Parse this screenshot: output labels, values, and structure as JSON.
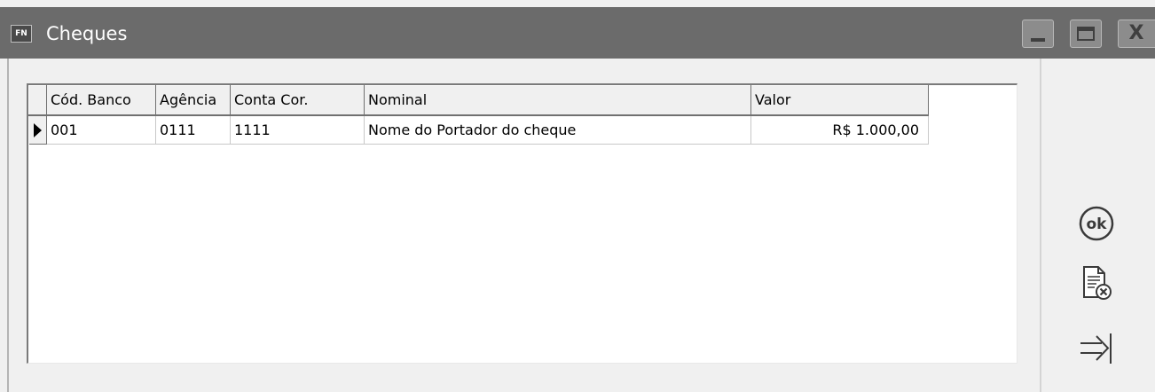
{
  "window": {
    "title": "Cheques",
    "icon_label": "FN",
    "controls": [
      "minimize-icon",
      "maximize-icon",
      "close-icon"
    ],
    "close_glyph": "X"
  },
  "grid": {
    "columns": [
      "Cód. Banco",
      "Agência",
      "Conta Cor.",
      "Nominal",
      "Valor"
    ],
    "rows": [
      {
        "cod_banco": "001",
        "agencia": "0111",
        "conta_cor": "1111",
        "nominal": "Nome do Portador do cheque",
        "valor": "R$ 1.000,00",
        "current": true
      }
    ]
  },
  "side_buttons": {
    "ok": "ok",
    "cancel_icon": "document-cancel-icon",
    "exit_icon": "exit-arrow-icon"
  },
  "colors": {
    "titlebar": "#6b6b6b",
    "title_text": "#ffffff",
    "background": "#f0f0f0",
    "grid_background": "#ffffff",
    "icon_stroke": "#3a3a3a"
  }
}
